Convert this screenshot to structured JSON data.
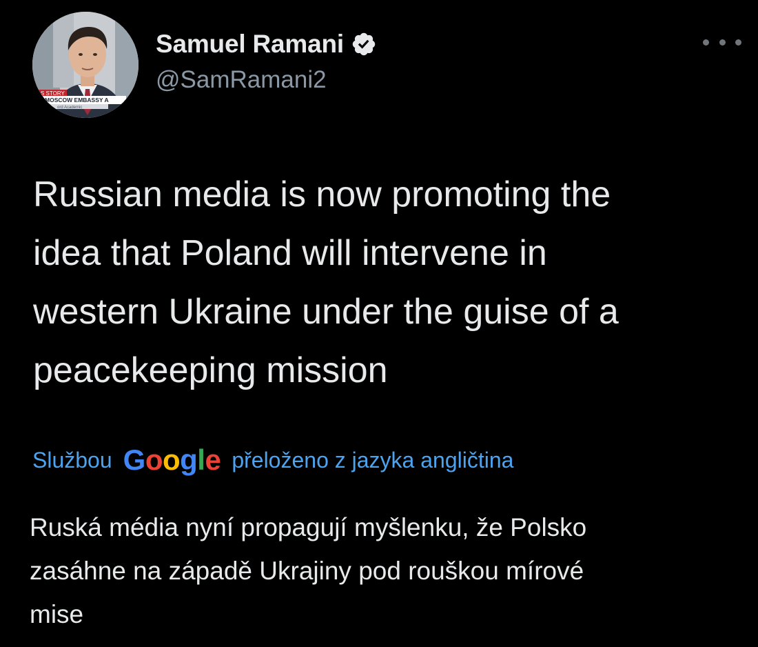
{
  "author": {
    "display_name": "Samuel Ramani",
    "handle": "@SamRamani2",
    "verified": true,
    "avatar_caption": {
      "line1": "S STORY",
      "line2": "E MOSCOW EMBASSY A",
      "line3": "ord Academic"
    }
  },
  "menu": {
    "icon": "more-horizontal-icon"
  },
  "tweet": {
    "text": "Russian media is now promoting the\nidea that Poland will intervene in\nwestern Ukraine under the guise of a\npeacekeeping mission"
  },
  "translation": {
    "prefix": "Službou",
    "provider_letters": [
      "G",
      "o",
      "o",
      "g",
      "l",
      "e"
    ],
    "suffix": "přeloženo z jazyka angličtina",
    "text": "Ruská média nyní propagují myšlenku, že Polsko\nzasáhne na západě Ukrajiny pod rouškou mírové\nmise"
  },
  "colors": {
    "background": "#000000",
    "text_primary": "#e7e9ea",
    "text_secondary": "#8b98a5",
    "link": "#4da3ee",
    "verified_badge": "#e7e9ea",
    "google": [
      "#4285f4",
      "#ea4335",
      "#fbbc05",
      "#4285f4",
      "#34a853",
      "#ea4335"
    ]
  }
}
